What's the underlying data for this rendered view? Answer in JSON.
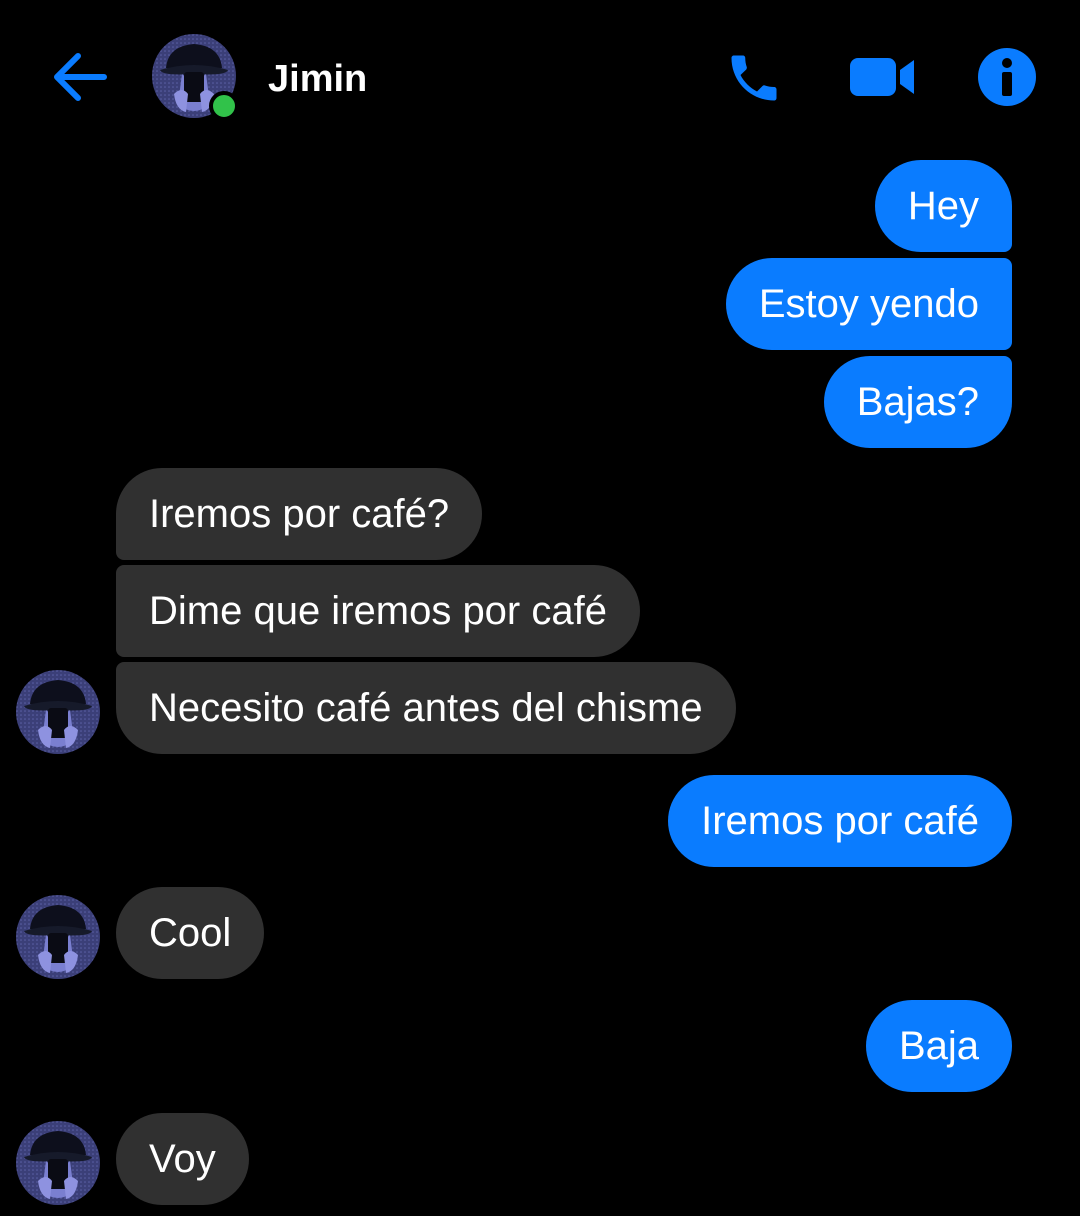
{
  "header": {
    "contact_name": "Jimin",
    "online": true,
    "accent_color": "#0a7cff",
    "online_color": "#31c24a",
    "icons": [
      "back-arrow-icon",
      "phone-icon",
      "video-camera-icon",
      "info-icon"
    ]
  },
  "messages": [
    {
      "sender": "me",
      "text": "Hey"
    },
    {
      "sender": "me",
      "text": "Estoy yendo"
    },
    {
      "sender": "me",
      "text": "Bajas?"
    },
    {
      "sender": "contact",
      "text": "Iremos por café?"
    },
    {
      "sender": "contact",
      "text": "Dime que iremos por café"
    },
    {
      "sender": "contact",
      "text": "Necesito café antes del chisme"
    },
    {
      "sender": "me",
      "text": "Iremos por café"
    },
    {
      "sender": "contact",
      "text": "Cool"
    },
    {
      "sender": "me",
      "text": "Baja"
    },
    {
      "sender": "contact",
      "text": "Voy"
    }
  ],
  "colors": {
    "outgoing_bubble": "#0a7cff",
    "incoming_bubble": "#303030",
    "background": "#000000"
  }
}
